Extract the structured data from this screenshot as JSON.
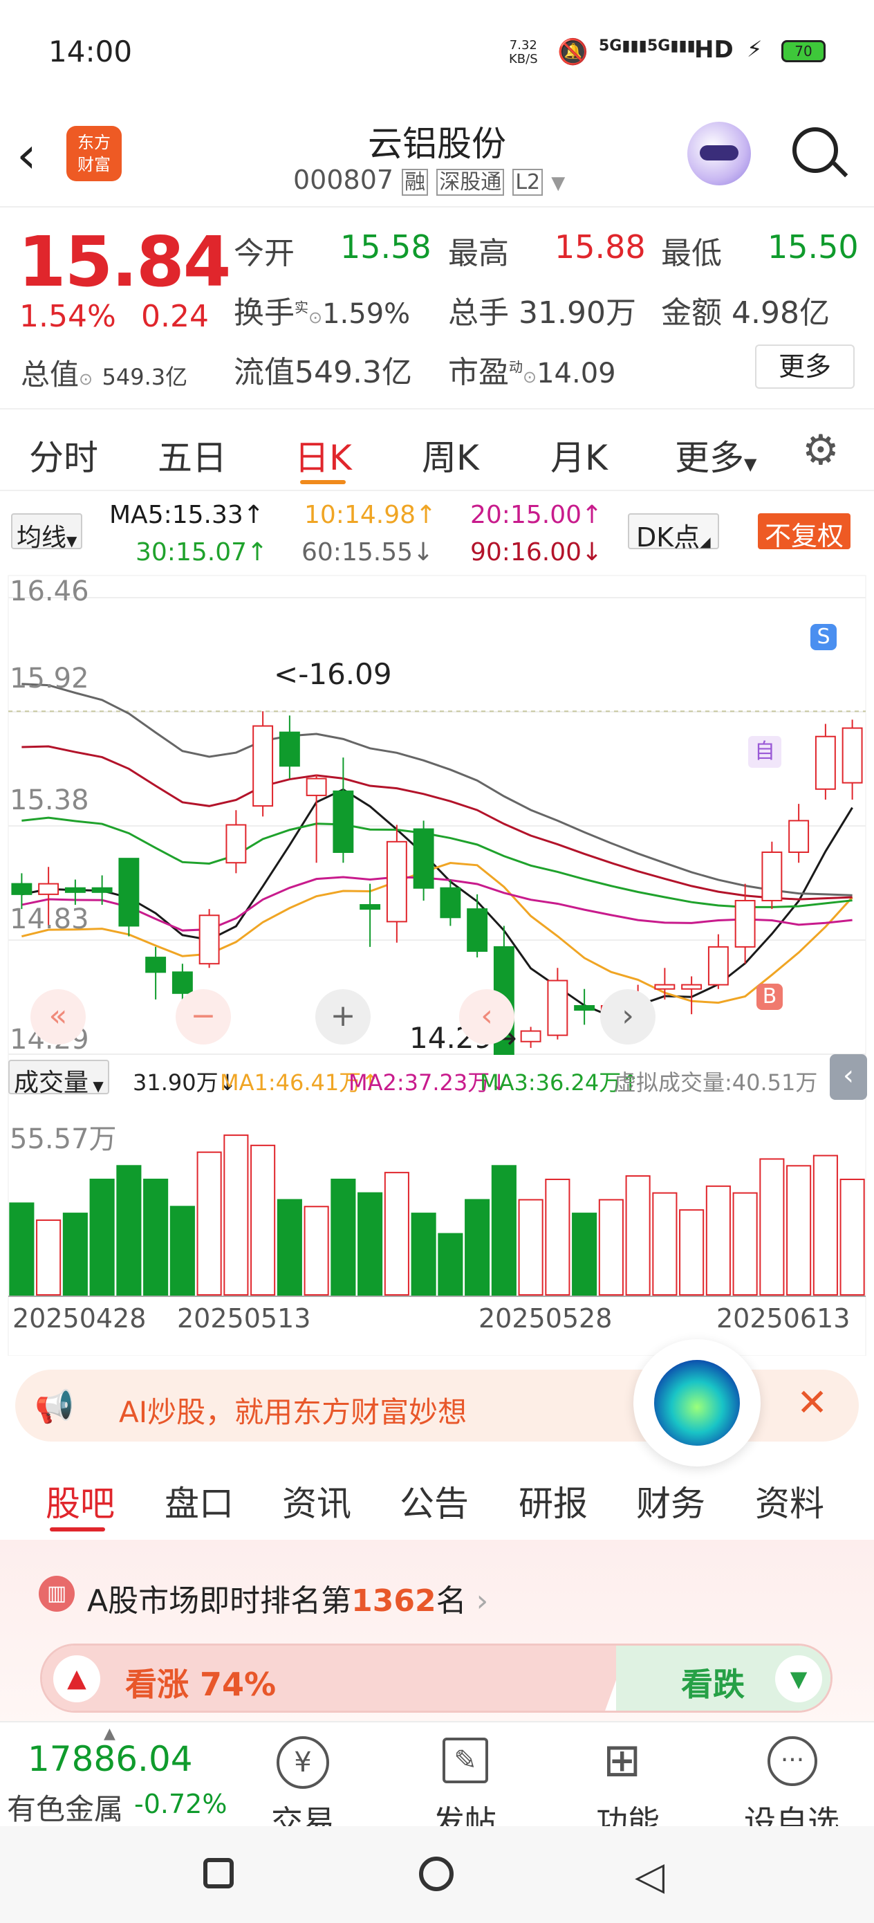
{
  "status": {
    "time": "14:00",
    "net_speed_top": "7.32",
    "net_speed_unit": "KB/S",
    "signal1": "5G",
    "signal2": "5G",
    "hd": "HD",
    "battery": "70"
  },
  "header": {
    "title": "云铝股份",
    "code": "000807",
    "tag_rong": "融",
    "tag_sgt": "深股通",
    "tag_l2": "L2",
    "logo_line1": "东方",
    "logo_line2": "财富"
  },
  "quote": {
    "price": "15.84",
    "pct": "1.54%",
    "chg": "0.24",
    "open_label": "今开",
    "open": "15.58",
    "high_label": "最高",
    "high": "15.88",
    "low_label": "最低",
    "low": "15.50",
    "turnover_label": "换手",
    "turnover_sup": "实",
    "turnover": "1.59%",
    "vol_label": "总手",
    "vol": "31.90万",
    "amount_label": "金额",
    "amount": "4.98亿",
    "mcap_label": "总值",
    "mcap": "549.3亿",
    "float_label": "流值",
    "float": "549.3亿",
    "pe_label": "市盈",
    "pe_sup": "动",
    "pe": "14.09",
    "more": "更多"
  },
  "tabs": [
    "分时",
    "五日",
    "日K",
    "周K",
    "月K",
    "更多"
  ],
  "ma_legend": {
    "selector": "均线",
    "ma5": "MA5:15.33↑",
    "ma10": "10:14.98↑",
    "ma20": "20:15.00↑",
    "ma30": "30:15.07↑",
    "ma60": "60:15.55↓",
    "ma90": "90:16.00↓",
    "dk": "DK点",
    "adjust": "不复权"
  },
  "chart_labels": {
    "y1": "16.46",
    "y2": "15.92",
    "y3": "15.38",
    "y4": "14.83",
    "y5": "14.29",
    "high_mark": "<-16.09",
    "low_mark": "14.29→",
    "s_badge": "S",
    "b_badge": "B",
    "self_badge": "自"
  },
  "colors": {
    "up": "#e0262c",
    "down": "#0f9b2c",
    "ma5": "#1a1a1a",
    "ma10": "#f0a524",
    "ma20": "#c81b8c",
    "ma30": "#1fa22c",
    "ma60": "#666666",
    "ma90": "#b3132a"
  },
  "chart_data": {
    "type": "candlestick",
    "ylim": [
      14.29,
      16.46
    ],
    "dates": [
      "20250428",
      "20250513",
      "20250528",
      "20250613"
    ],
    "candles": [
      [
        15.1,
        15.05,
        15.15,
        14.98
      ],
      [
        15.05,
        15.1,
        15.18,
        14.9
      ],
      [
        15.08,
        15.06,
        15.12,
        15.0
      ],
      [
        15.08,
        15.06,
        15.14,
        15.0
      ],
      [
        15.22,
        14.9,
        15.22,
        14.85
      ],
      [
        14.75,
        14.68,
        14.8,
        14.55
      ],
      [
        14.68,
        14.58,
        14.72,
        14.5
      ],
      [
        14.72,
        14.95,
        14.98,
        14.7
      ],
      [
        15.2,
        15.38,
        15.45,
        15.15
      ],
      [
        15.47,
        15.85,
        15.92,
        15.42
      ],
      [
        15.82,
        15.66,
        15.9,
        15.6
      ],
      [
        15.52,
        15.6,
        15.62,
        15.2
      ],
      [
        15.54,
        15.25,
        15.7,
        15.2
      ],
      [
        15.0,
        14.98,
        15.1,
        14.8
      ],
      [
        14.92,
        15.3,
        15.38,
        14.82
      ],
      [
        15.36,
        15.08,
        15.4,
        15.02
      ],
      [
        15.08,
        14.94,
        15.12,
        14.9
      ],
      [
        14.98,
        14.78,
        15.05,
        14.75
      ],
      [
        14.8,
        14.29,
        14.9,
        14.29
      ],
      [
        14.35,
        14.4,
        14.42,
        14.32
      ],
      [
        14.38,
        14.64,
        14.7,
        14.36
      ],
      [
        14.52,
        14.5,
        14.6,
        14.43
      ],
      [
        14.49,
        14.52,
        14.55,
        14.4
      ],
      [
        14.52,
        14.55,
        14.62,
        14.45
      ],
      [
        14.6,
        14.62,
        14.7,
        14.55
      ],
      [
        14.6,
        14.62,
        14.66,
        14.48
      ],
      [
        14.62,
        14.8,
        14.86,
        14.6
      ],
      [
        14.8,
        15.02,
        15.1,
        14.72
      ],
      [
        15.02,
        15.25,
        15.3,
        14.98
      ],
      [
        15.25,
        15.4,
        15.48,
        15.2
      ],
      [
        15.55,
        15.8,
        15.86,
        15.5
      ],
      [
        15.58,
        15.84,
        15.88,
        15.5
      ]
    ],
    "ma_values": {
      "MA5": 15.33,
      "MA10": 14.98,
      "MA20": 15.0,
      "MA30": 15.07,
      "MA60": 15.55,
      "MA90": 16.0
    },
    "volume": {
      "label": "成交量",
      "current": "31.90万↓",
      "ma1": "MA1:46.41万↑",
      "ma2": "MA2:37.23万↓",
      "ma3": "MA3:36.24万↑",
      "virtual": "虚拟成交量:40.51万",
      "axis_max": "55.57万",
      "values": [
        27,
        22,
        24,
        34,
        38,
        34,
        26,
        42,
        47,
        44,
        28,
        26,
        34,
        30,
        36,
        24,
        18,
        28,
        38,
        28,
        34,
        24,
        28,
        35,
        30,
        25,
        32,
        30,
        40,
        38,
        41,
        34
      ]
    }
  },
  "banner": {
    "text": "AI炒股，就用东方财富妙想"
  },
  "bottom_tabs": [
    "股吧",
    "盘口",
    "资讯",
    "公告",
    "研报",
    "财务",
    "资料"
  ],
  "rank": {
    "prefix": "A股市场即时排名第",
    "num": "1362",
    "suffix": "名",
    "up_label": "看涨 74%",
    "down_label": "看跌"
  },
  "bottom_bar": {
    "index_value": "17886.04",
    "index_name": "有色金属",
    "index_chg": "-0.72%",
    "items": [
      "交易",
      "发帖",
      "功能",
      "设自选"
    ]
  }
}
